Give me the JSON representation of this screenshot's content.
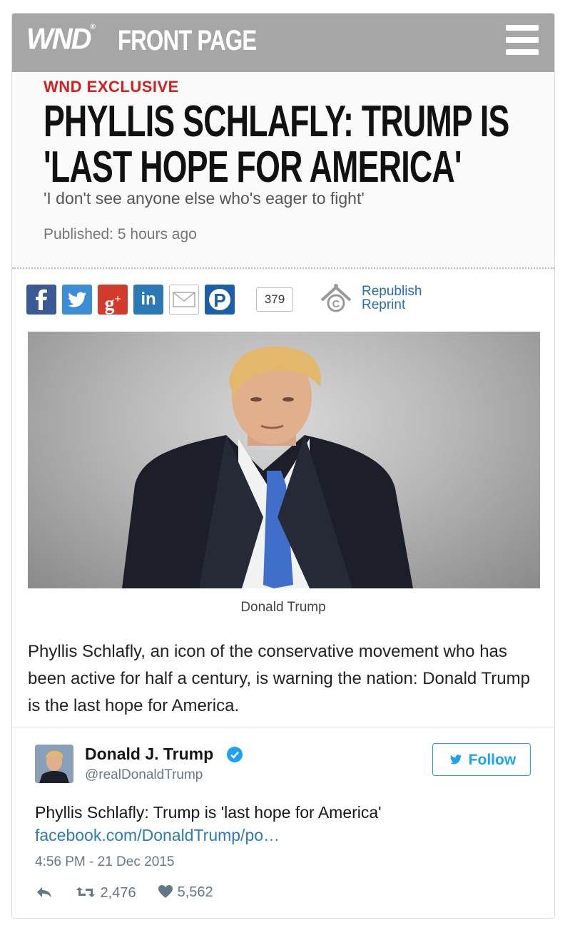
{
  "header": {
    "logo": "WND",
    "logo_mark": "®",
    "section": "FRONT PAGE"
  },
  "article": {
    "kicker": "WND EXCLUSIVE",
    "headline": "PHYLLIS SCHLAFLY: TRUMP IS 'LAST HOPE FOR AMERICA'",
    "dek": "'I don't see anyone else who's eager to fight'",
    "published": "Published: 5 hours ago",
    "share_count": "379",
    "republish_label": "Republish",
    "reprint_label": "Reprint",
    "photo_caption": "Donald Trump",
    "body": "Phyllis Schlafly, an icon of the conservative movement who has been active for half a century, is warning the nation: Donald Trump is the last hope for America."
  },
  "share_buttons": [
    {
      "icon": "facebook-icon",
      "glyph": "f",
      "color": "#3b5998"
    },
    {
      "icon": "twitter-icon",
      "glyph": "",
      "color": "#3b8ed6"
    },
    {
      "icon": "google-plus-icon",
      "glyph": "g+",
      "color": "#d23a2b"
    },
    {
      "icon": "linkedin-icon",
      "glyph": "in",
      "color": "#2b78b7"
    },
    {
      "icon": "email-icon",
      "glyph": "",
      "color": "#ffffff"
    },
    {
      "icon": "pinterest-icon",
      "glyph": "P",
      "color": "#1b5fa8"
    }
  ],
  "tweet": {
    "name": "Donald J. Trump",
    "handle": "@realDonaldTrump",
    "follow_label": "Follow",
    "text": "Phyllis Schlafly: Trump is 'last hope for America'",
    "link": "facebook.com/DonaldTrump/po…",
    "timestamp": "4:56 PM - 21 Dec 2015",
    "retweets": "2,476",
    "likes": "5,562",
    "accent_color": "#1da1f2"
  }
}
